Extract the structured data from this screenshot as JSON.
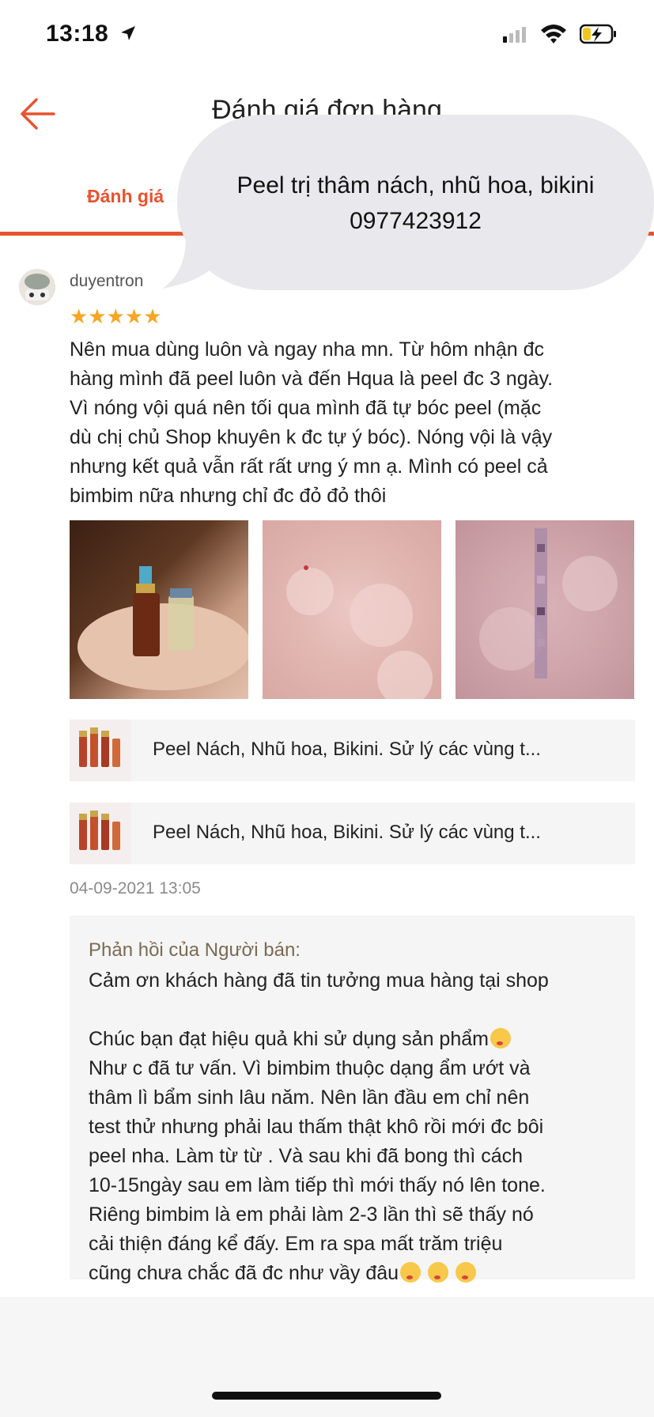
{
  "status_bar": {
    "time": "13:18",
    "signal_bars_active": 1,
    "signal_bars_total": 4
  },
  "header": {
    "title": "Đánh giá đơn hàng"
  },
  "tabs": [
    {
      "label": "Đánh giá",
      "active": true
    }
  ],
  "overlay_bubble": {
    "lines": [
      "Peel trị thâm nách, nhũ hoa, bikini",
      "0977423912"
    ]
  },
  "review": {
    "username": "duyentron",
    "rating": 5,
    "stars": "★★★★★",
    "text_lines": [
      "Nên mua dùng luôn và ngay nha mn. Từ hôm nhận đc",
      "hàng mình đã peel luôn và đến Hqua là peel đc 3 ngày.",
      "Vì nóng vội quá nên tối qua mình đã tự bóc peel (mặc",
      "dù chị chủ Shop khuyên k đc tự ý bóc). Nóng vội là vậy",
      "nhưng kết quả vẫn rất rất ưng ý mn ạ. Mình có peel cả",
      "bimbim nữa nhưng chỉ đc đỏ đỏ thôi"
    ],
    "photo_count": 3,
    "products": [
      {
        "name": "Peel Nách, Nhũ hoa, Bikini. Sử lý các vùng t..."
      },
      {
        "name": "Peel Nách, Nhũ hoa, Bikini. Sử lý các vùng t..."
      }
    ],
    "date": "04-09-2021 13:05"
  },
  "seller_reply": {
    "label": "Phản hồi của Người bán:",
    "lines": [
      "Cảm ơn khách hàng đã tin tưởng mua hàng tại shop",
      "",
      "Chúc bạn đạt hiệu quả khi sử dụng sản phẩm",
      "Như c đã tư vấn. Vì bimbim thuộc dạng ẩm ướt và",
      "thâm lì bẩm sinh lâu năm. Nên lần đầu em chỉ nên",
      "test thử nhưng phải lau thấm thật khô rồi mới đc bôi",
      "peel nha. Làm từ từ . Và sau khi đã bong thì cách",
      "10-15ngày sau em làm tiếp thì mới thấy nó lên tone.",
      "Riêng bimbim là em phải làm 2-3 lần thì sẽ thấy nó",
      "cải thiện đáng kể đấy. Em ra spa mất trăm triệu",
      "cũng chưa chắc đã đc như vầy đâu"
    ]
  },
  "colors": {
    "accent": "#e8532f",
    "star": "#f6a623",
    "bubble": "#e9e9ed",
    "panel": "#f5f5f5",
    "seller_label": "#7a6a52"
  },
  "icons": {
    "back": "arrow-left-icon",
    "location": "location-arrow-icon",
    "wifi": "wifi-icon",
    "battery": "battery-charging-icon"
  }
}
